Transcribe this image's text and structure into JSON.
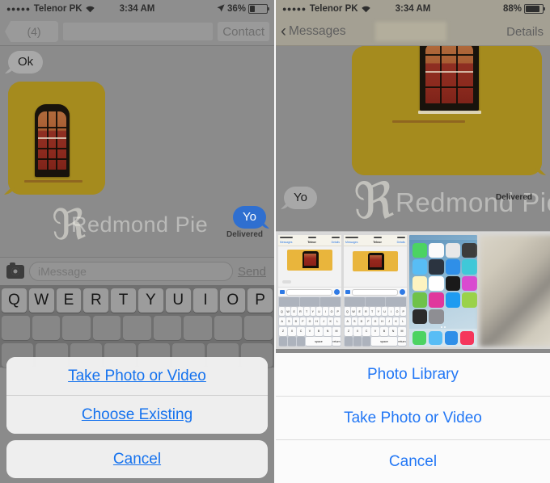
{
  "left": {
    "status_bar": {
      "signal_dots": "●●●●●",
      "carrier": "Telenor PK",
      "wifi_icon": "wifi-icon",
      "time": "3:34 AM",
      "location_icon": "location-arrow-icon",
      "battery_percent": "36%",
      "battery_level": 36
    },
    "nav_bar": {
      "back_label": "(4)",
      "contact_name": "",
      "right_button": "Contact"
    },
    "messages": [
      {
        "sender": "them",
        "type": "text",
        "text": "Ok"
      },
      {
        "sender": "them",
        "type": "photo",
        "watermark": "Redmond Pie"
      },
      {
        "sender": "me",
        "type": "text",
        "text": "Yo",
        "status": "Delivered"
      }
    ],
    "input_bar": {
      "camera_icon": "camera-icon",
      "placeholder": "iMessage",
      "value": "",
      "send_label": "Send"
    },
    "keyboard_row": [
      "Q",
      "W",
      "E",
      "R",
      "T",
      "Y",
      "U",
      "I",
      "O",
      "P"
    ],
    "action_sheet": {
      "items": [
        "Take Photo or Video",
        "Choose Existing"
      ],
      "cancel": "Cancel"
    }
  },
  "right": {
    "status_bar": {
      "signal_dots": "●●●●●",
      "carrier": "Telenor PK",
      "wifi_icon": "wifi-icon",
      "time": "3:34 AM",
      "battery_percent": "88%",
      "battery_level": 88
    },
    "nav_bar": {
      "back_icon": "chevron-left-icon",
      "back_label": "Messages",
      "contact_name": "",
      "right_button": "Details"
    },
    "messages": [
      {
        "sender": "them",
        "type": "photo",
        "watermark": "Redmond Pie",
        "status": "Delivered"
      },
      {
        "sender": "them",
        "type": "text",
        "text": "Yo"
      }
    ],
    "photo_strip": {
      "thumbnails": [
        {
          "name": "messages-screenshot-1"
        },
        {
          "name": "messages-screenshot-2"
        },
        {
          "name": "ios-home-screen"
        },
        {
          "name": "blurred-photo"
        }
      ],
      "mini": {
        "back": "Messages",
        "title": "Telnor",
        "details": "Details",
        "keys_row1": [
          "Q",
          "W",
          "E",
          "R",
          "T",
          "Y",
          "U",
          "I",
          "O",
          "P"
        ],
        "keys_row2": [
          "A",
          "S",
          "D",
          "F",
          "G",
          "H",
          "J",
          "K",
          "L"
        ],
        "keys_row3": [
          "Z",
          "X",
          "C",
          "V",
          "B",
          "N",
          "M"
        ],
        "space": "space",
        "return": "return"
      }
    },
    "action_sheet": {
      "items": [
        "Photo Library",
        "Take Photo or Video",
        "Cancel"
      ]
    }
  },
  "colors": {
    "ios_blue": "#1272f2",
    "bubble_blue": "#2f6fd0",
    "bubble_gray": "#a8a8a8",
    "photo_wall": "#a58b1e",
    "dimmed_bg": "#8b8b8b",
    "sheet_bg": "#f2f2f2"
  }
}
